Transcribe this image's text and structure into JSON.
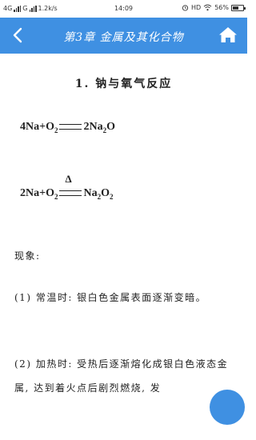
{
  "status_bar": {
    "network": "4G",
    "carrier_mark": "G",
    "speed": "1.2k/s",
    "time": "14:09",
    "hd": "HD",
    "battery": "56%",
    "battery_level": 0.56
  },
  "app_bar": {
    "title": "第3章 金属及其化合物",
    "back_icon": "chevron-left-icon",
    "home_icon": "home-icon",
    "accent_color": "#3f90e2"
  },
  "content": {
    "section_title": "1. 钠与氧气反应",
    "equation1": {
      "reactant1": "4Na+O",
      "reactant1_sub": "2",
      "product": "2Na",
      "product_sub": "2",
      "product_tail": "O"
    },
    "equation2": {
      "reactant": "2Na+O",
      "reactant_sub": "2",
      "condition": "Δ",
      "product1": "Na",
      "product1_sub": "2",
      "product2": "O",
      "product2_sub": "2"
    },
    "phenomenon_label": "现象:",
    "phenomenon1": "(1) 常温时: 银白色金属表面逐渐变暗。",
    "phenomenon2": "(2) 加热时: 受热后逐渐熔化成银白色液态金属, 达到着火点后剧烈燃烧, 发"
  }
}
